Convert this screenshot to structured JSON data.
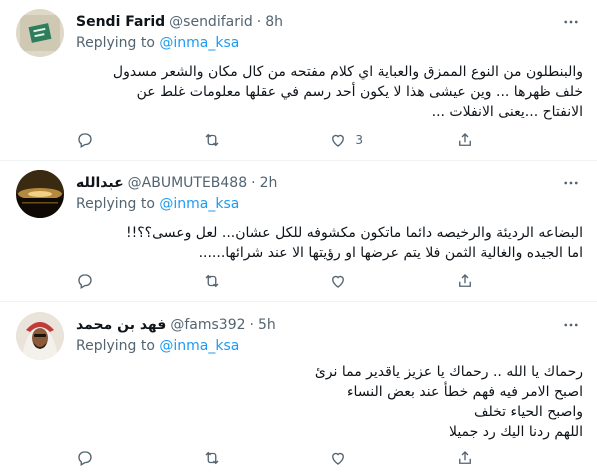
{
  "tweets": [
    {
      "name": "Sendi Farid",
      "handle": "@sendifarid",
      "dot": "·",
      "time": "8h",
      "replying_prefix": "Replying to",
      "mention": "@inma_ksa",
      "body_lines": [
        "والبنطلون من النوع الممزق والعباية اي كلام مفتحه من كال مكان  والشعر مسدول",
        "خلف ظهرها ... وين عيشى هذا  لا يكون أحد رسم في عقلها معلومات غلط عن",
        "الانفتاح ...يعنى الانفلات ..."
      ],
      "actions": {
        "reply": "",
        "retweet": "",
        "like": "3",
        "share": ""
      }
    },
    {
      "name": "عبدالله",
      "handle": "@ABUMUTEB488",
      "dot": "·",
      "time": "2h",
      "replying_prefix": "Replying to",
      "mention": "@inma_ksa",
      "body_lines": [
        "البضاعه الرديئة والرخيصه دائما ماتكون مكشوفه للكل عشان... لعل وعسى؟؟!!",
        "اما الجيده  والغالية الثمن فلا يتم عرضها او رؤيتها الا عند شرائها......"
      ],
      "actions": {
        "reply": "",
        "retweet": "",
        "like": "",
        "share": ""
      }
    },
    {
      "name": "فهد بن محمد",
      "handle": "@fams392",
      "dot": "·",
      "time": "5h",
      "replying_prefix": "Replying to",
      "mention": "@inma_ksa",
      "body_lines": [
        "رحماك يا الله .. رحماك يا عزيز ياقدير مما نرئ",
        "اصبح الامر فيه فهم خطأ عند بعض النساء",
        "واصبح الحياء تخلف",
        "اللهم ردنا اليك رد جميلا"
      ],
      "actions": {
        "reply": "",
        "retweet": "",
        "like": "",
        "share": ""
      }
    }
  ]
}
